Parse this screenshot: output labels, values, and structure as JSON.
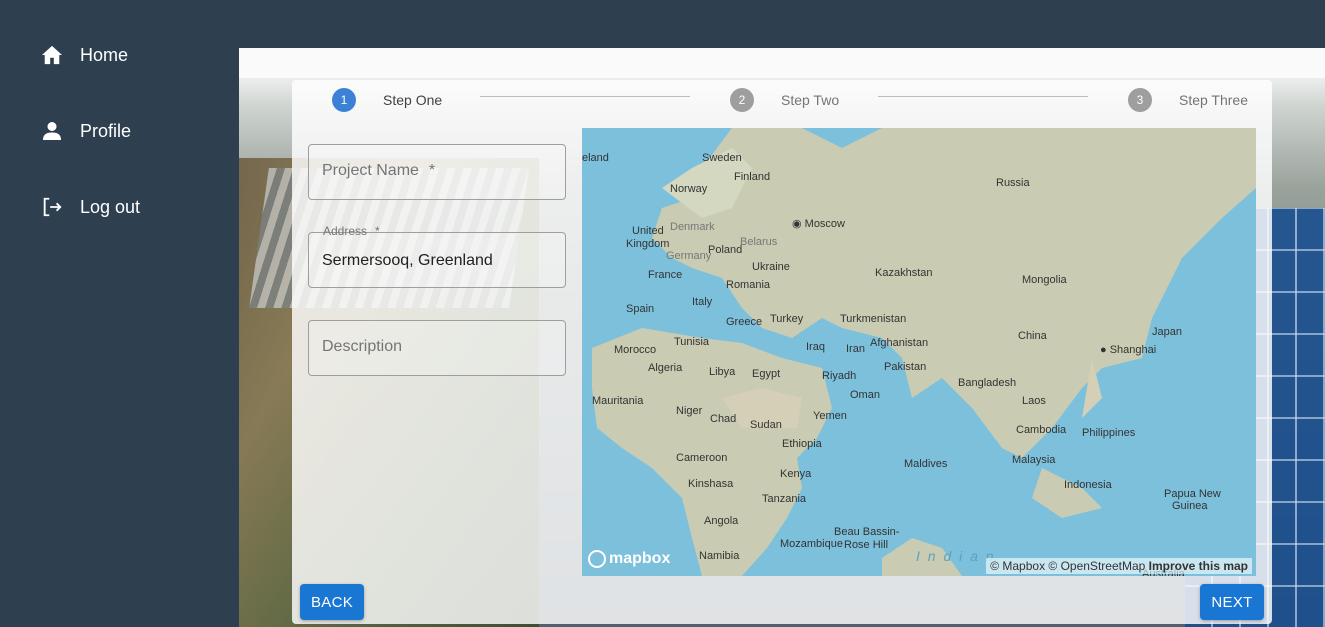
{
  "sidebar": {
    "items": [
      {
        "label": "Home",
        "icon": "home-icon"
      },
      {
        "label": "Profile",
        "icon": "person-icon"
      },
      {
        "label": "Log out",
        "icon": "logout-icon"
      }
    ]
  },
  "stepper": {
    "steps": [
      {
        "number": "1",
        "label": "Step One",
        "active": true
      },
      {
        "number": "2",
        "label": "Step Two",
        "active": false
      },
      {
        "number": "3",
        "label": "Step Three",
        "active": false
      }
    ],
    "active_color": "#3b82d6",
    "inactive_color": "#9e9e9e"
  },
  "form": {
    "project_name": {
      "placeholder": "Project Name",
      "required_mark": "*",
      "value": ""
    },
    "address": {
      "label": "Address",
      "required_mark": "*",
      "value": "Sermersooq, Greenland"
    },
    "description": {
      "placeholder": "Description",
      "value": ""
    }
  },
  "map": {
    "labels": {
      "iceland": "eland",
      "sweden": "Sweden",
      "finland": "Finland",
      "norway": "Norway",
      "russia": "Russia",
      "moscow": "Moscow",
      "united_kingdom_1": "United",
      "united_kingdom_2": "Kingdom",
      "denmark": "Denmark",
      "belarus": "Belarus",
      "poland": "Poland",
      "germany": "Germany",
      "ukraine": "Ukraine",
      "france": "France",
      "kazakhstan": "Kazakhstan",
      "romania": "Romania",
      "mongolia": "Mongolia",
      "italy": "Italy",
      "spain": "Spain",
      "greece": "Greece",
      "turkey": "Turkey",
      "turkmenistan": "Turkmenistan",
      "japan": "Japan",
      "china": "China",
      "afghanistan": "Afghanistan",
      "tunisia": "Tunisia",
      "morocco": "Morocco",
      "iraq": "Iraq",
      "iran": "Iran",
      "shanghai": "Shanghai",
      "algeria": "Algeria",
      "libya": "Libya",
      "egypt": "Egypt",
      "riyadh": "Riyadh",
      "pakistan": "Pakistan",
      "bangladesh": "Bangladesh",
      "oman": "Oman",
      "mauritania": "Mauritania",
      "niger": "Niger",
      "chad": "Chad",
      "sudan": "Sudan",
      "yemen": "Yemen",
      "laos": "Laos",
      "cambodia": "Cambodia",
      "philippines": "Philippines",
      "ethiopia": "Ethiopia",
      "cameroon": "Cameroon",
      "maldives": "Maldives",
      "malaysia": "Malaysia",
      "kenya": "Kenya",
      "indonesia": "Indonesia",
      "kinshasa": "Kinshasa",
      "tanzania": "Tanzania",
      "papua_1": "Papua New",
      "papua_2": "Guinea",
      "angola": "Angola",
      "beau_1": "Beau Bassin-",
      "beau_2": "Rose Hill",
      "mozambique": "Mozambique",
      "namibia": "Namibia",
      "indian": "I n d i a n",
      "australia": "Australia"
    },
    "attribution_prefix": "© Mapbox © OpenStreetMap",
    "attribution_link": "Improve this map",
    "logo": "mapbox"
  },
  "buttons": {
    "back": "BACK",
    "next": "NEXT"
  }
}
